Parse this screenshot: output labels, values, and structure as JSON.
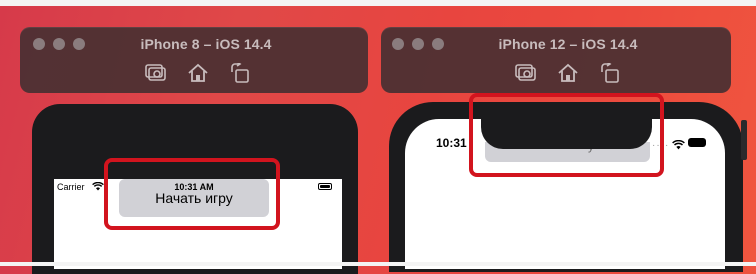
{
  "simulators": [
    {
      "title": "iPhone 8 – iOS 14.4",
      "tools": [
        "screenshot-icon",
        "home-icon",
        "rotate-icon"
      ],
      "status": {
        "carrier": "Carrier",
        "time": "10:31 AM"
      },
      "button_label": "Начать игру"
    },
    {
      "title": "iPhone 12 – iOS 14.4",
      "tools": [
        "screenshot-icon",
        "home-icon",
        "rotate-icon"
      ],
      "status": {
        "time": "10:31",
        "partial_button_text": "у"
      },
      "button_label": ""
    }
  ],
  "colors": {
    "highlight": "#d2141e",
    "background": "#e8453f",
    "button": "#d1d1d6"
  }
}
